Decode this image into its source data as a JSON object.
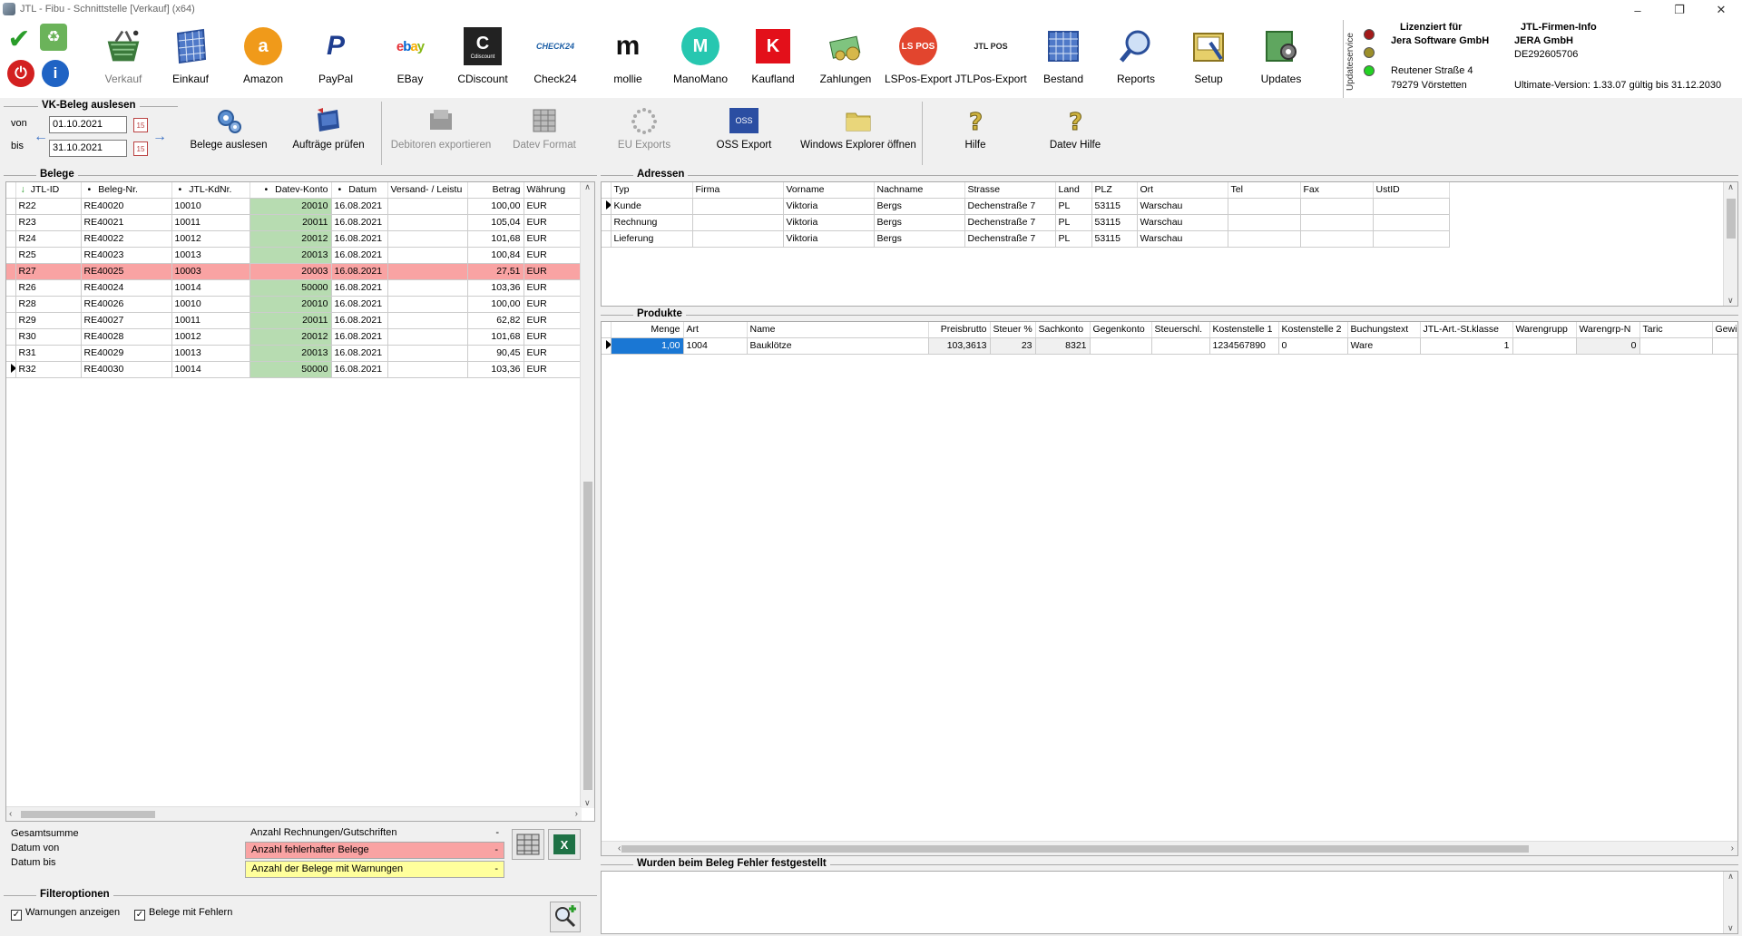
{
  "window": {
    "title": "JTL - Fibu - Schnittstelle [Verkauf] (x64)"
  },
  "ribbon": {
    "items": [
      {
        "label": "Verkauf",
        "icon": "basket-icon"
      },
      {
        "label": "Einkauf",
        "icon": "grid-building-icon"
      },
      {
        "label": "Amazon",
        "icon": "amazon-icon"
      },
      {
        "label": "PayPal",
        "icon": "paypal-icon"
      },
      {
        "label": "EBay",
        "icon": "ebay-icon"
      },
      {
        "label": "CDiscount",
        "icon": "cdiscount-icon"
      },
      {
        "label": "Check24",
        "icon": "check24-icon"
      },
      {
        "label": "mollie",
        "icon": "mollie-icon"
      },
      {
        "label": "ManoMano",
        "icon": "manomano-icon"
      },
      {
        "label": "Kaufland",
        "icon": "kaufland-icon"
      },
      {
        "label": "Zahlungen",
        "icon": "money-icon"
      },
      {
        "label": "LSPos-Export",
        "icon": "lspos-icon"
      },
      {
        "label": "JTLPos-Export",
        "icon": "jtlpos-icon"
      },
      {
        "label": "Bestand",
        "icon": "inventory-icon"
      },
      {
        "label": "Reports",
        "icon": "magnifier-icon"
      },
      {
        "label": "Setup",
        "icon": "setup-icon"
      },
      {
        "label": "Updates",
        "icon": "updates-icon"
      }
    ],
    "brand_labels": {
      "amazon": "a",
      "paypal": "P",
      "ebay": "ebay",
      "cdiscount": "C",
      "cdiscount_sub": "Cdiscount",
      "check24": "CHECK24",
      "mollie": "m",
      "manomano": "M",
      "kaufland": "K",
      "lspos": "LS POS",
      "jtlpos": "JTL POS"
    }
  },
  "license": {
    "vertical_label": "Updateservice",
    "licensed_for_title": "Lizenziert für",
    "licensed_for_name": "Jera Software GmbH",
    "street": "Reutener Straße 4",
    "city": "79279 Vörstetten",
    "firm_title": "JTL-Firmen-Info",
    "firm_name": "JERA GmbH",
    "firm_vat": "DE292605706",
    "version": "Ultimate-Version: 1.33.07 gültig bis 31.12.2030"
  },
  "vk": {
    "title": "VK-Beleg auslesen",
    "von_label": "von",
    "bis_label": "bis",
    "von_value": "01.10.2021",
    "bis_value": "31.10.2021",
    "cal_label": "15"
  },
  "toolbar": {
    "belege_auslesen": "Belege auslesen",
    "auftraege_pruefen": "Aufträge prüfen",
    "debitoren_exportieren": "Debitoren exportieren",
    "datev_format": "Datev Format",
    "eu_exports": "EU Exports",
    "oss_export": "OSS Export",
    "oss_badge": "OSS",
    "windows_explorer": "Windows Explorer öffnen",
    "hilfe": "Hilfe",
    "datev_hilfe": "Datev Hilfe"
  },
  "belege": {
    "title": "Belege",
    "columns": [
      "JTL-ID",
      "Beleg-Nr.",
      "JTL-KdNr.",
      "Datev-Konto",
      "Datum",
      "Versand- / Leistu",
      "Betrag",
      "Währung"
    ],
    "rows": [
      [
        "R22",
        "RE40020",
        "10010",
        "20010",
        "16.08.2021",
        "",
        "100,00",
        "EUR"
      ],
      [
        "R23",
        "RE40021",
        "10011",
        "20011",
        "16.08.2021",
        "",
        "105,04",
        "EUR"
      ],
      [
        "R24",
        "RE40022",
        "10012",
        "20012",
        "16.08.2021",
        "",
        "101,68",
        "EUR"
      ],
      [
        "R25",
        "RE40023",
        "10013",
        "20013",
        "16.08.2021",
        "",
        "100,84",
        "EUR"
      ],
      [
        "R27",
        "RE40025",
        "10003",
        "20003",
        "16.08.2021",
        "",
        "27,51",
        "EUR"
      ],
      [
        "R26",
        "RE40024",
        "10014",
        "50000",
        "16.08.2021",
        "",
        "103,36",
        "EUR"
      ],
      [
        "R28",
        "RE40026",
        "10010",
        "20010",
        "16.08.2021",
        "",
        "100,00",
        "EUR"
      ],
      [
        "R29",
        "RE40027",
        "10011",
        "20011",
        "16.08.2021",
        "",
        "62,82",
        "EUR"
      ],
      [
        "R30",
        "RE40028",
        "10012",
        "20012",
        "16.08.2021",
        "",
        "101,68",
        "EUR"
      ],
      [
        "R31",
        "RE40029",
        "10013",
        "20013",
        "16.08.2021",
        "",
        "90,45",
        "EUR"
      ],
      [
        "R32",
        "RE40030",
        "10014",
        "50000",
        "16.08.2021",
        "",
        "103,36",
        "EUR"
      ]
    ]
  },
  "summary": {
    "gesamtsumme": "Gesamtsumme",
    "datum_von": "Datum von",
    "datum_bis": "Datum bis",
    "anzahl_rechnungen": "Anzahl Rechnungen/Gutschriften",
    "anzahl_rechnungen_val": "-",
    "anzahl_fehlerhaft": "Anzahl fehlerhafter Belege",
    "anzahl_fehlerhaft_val": "-",
    "anzahl_warnungen": "Anzahl der Belege mit Warnungen",
    "anzahl_warnungen_val": "-",
    "error_color": "#f9a3a3",
    "warn_color": "#ffff9c"
  },
  "filter": {
    "title": "Filteroptionen",
    "warnungen": "Warnungen anzeigen",
    "fehlern": "Belege mit Fehlern"
  },
  "adressen": {
    "title": "Adressen",
    "columns": [
      "Typ",
      "Firma",
      "Vorname",
      "Nachname",
      "Strasse",
      "Land",
      "PLZ",
      "Ort",
      "Tel",
      "Fax",
      "UstID"
    ],
    "rows": [
      [
        "Kunde",
        "",
        "Viktoria",
        "Bergs",
        "Dechenstraße 7",
        "PL",
        "53115",
        "Warschau",
        "",
        "",
        ""
      ],
      [
        "Rechnung",
        "",
        "Viktoria",
        "Bergs",
        "Dechenstraße 7",
        "PL",
        "53115",
        "Warschau",
        "",
        "",
        ""
      ],
      [
        "Lieferung",
        "",
        "Viktoria",
        "Bergs",
        "Dechenstraße 7",
        "PL",
        "53115",
        "Warschau",
        "",
        "",
        ""
      ]
    ]
  },
  "produkte": {
    "title": "Produkte",
    "columns": [
      "Menge",
      "Art",
      "Name",
      "Preisbrutto",
      "Steuer %",
      "Sachkonto",
      "Gegenkonto",
      "Steuerschl.",
      "Kostenstelle 1",
      "Kostenstelle 2",
      "Buchungstext",
      "JTL-Art.-St.klasse",
      "Warengrupp",
      "Warengrp-N",
      "Taric",
      "Gewi"
    ],
    "rows": [
      [
        "1,00",
        "1004",
        "Bauklötze",
        "103,3613",
        "23",
        "8321",
        "",
        "",
        "1234567890",
        "0",
        "Ware",
        "1",
        "",
        "0",
        "",
        ""
      ]
    ]
  },
  "fehler": {
    "title": "Wurden beim Beleg Fehler festgestellt"
  }
}
